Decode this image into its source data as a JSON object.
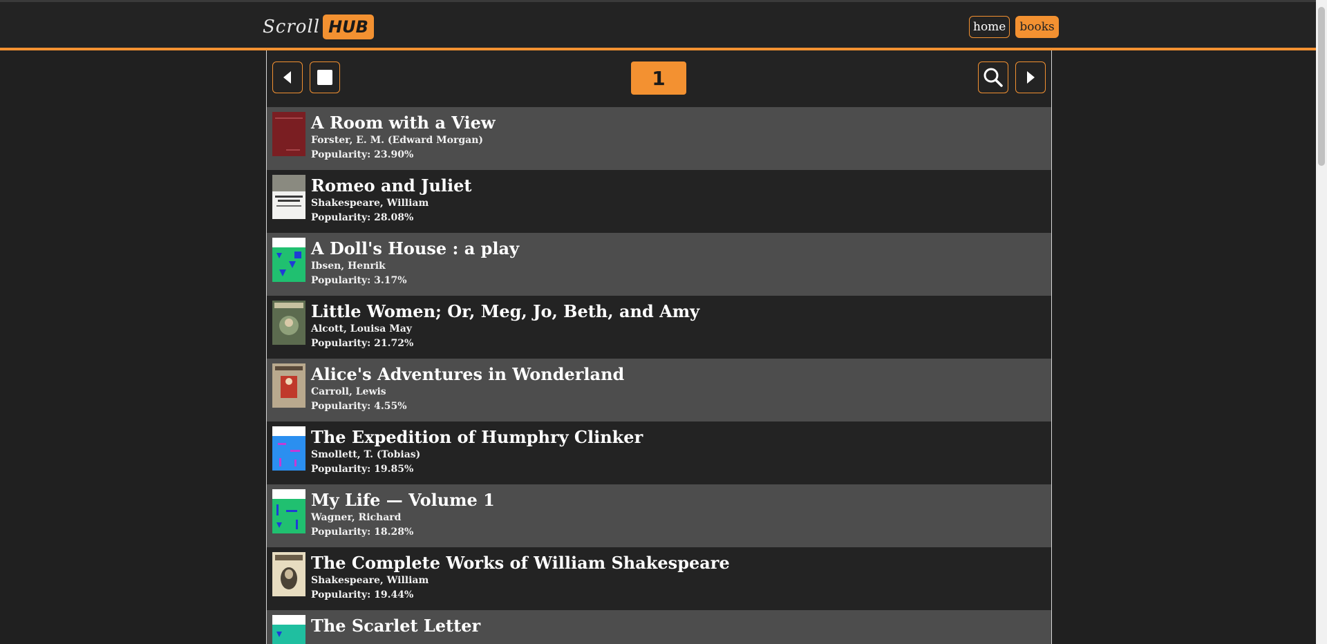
{
  "header": {
    "logo_script": "Scroll",
    "logo_badge": "HUB",
    "nav": {
      "home_label": "home",
      "books_label": "books"
    }
  },
  "toolbar": {
    "page_number": "1"
  },
  "books": [
    {
      "title": "A Room with a View",
      "author": "Forster, E. M. (Edward Morgan)",
      "popularity": "Popularity: 23.90%",
      "cover": "maroon-cover"
    },
    {
      "title": "Romeo and Juliet",
      "author": "Shakespeare, William",
      "popularity": "Popularity: 28.08%",
      "cover": "white-title-cover"
    },
    {
      "title": "A Doll's House : a play",
      "author": "Ibsen, Henrik",
      "popularity": "Popularity: 3.17%",
      "cover": "green-pattern-cover"
    },
    {
      "title": "Little Women; Or, Meg, Jo, Beth, and Amy",
      "author": "Alcott, Louisa May",
      "popularity": "Popularity: 21.72%",
      "cover": "illustrated-cover"
    },
    {
      "title": "Alice's Adventures in Wonderland",
      "author": "Carroll, Lewis",
      "popularity": "Popularity: 4.55%",
      "cover": "alice-cover"
    },
    {
      "title": "The Expedition of Humphry Clinker",
      "author": "Smollett, T. (Tobias)",
      "popularity": "Popularity: 19.85%",
      "cover": "blue-pattern-cover"
    },
    {
      "title": "My Life — Volume 1",
      "author": "Wagner, Richard",
      "popularity": "Popularity: 18.28%",
      "cover": "green-pattern-cover"
    },
    {
      "title": "The Complete Works of William Shakespeare",
      "author": "Shakespeare, William",
      "popularity": "Popularity: 19.44%",
      "cover": "portrait-cover"
    },
    {
      "title": "The Scarlet Letter",
      "author": "",
      "popularity": "",
      "cover": "teal-pattern-cover"
    }
  ],
  "colors": {
    "accent": "#f39131",
    "background": "#232323",
    "row_alt": "#4d4d4d"
  }
}
